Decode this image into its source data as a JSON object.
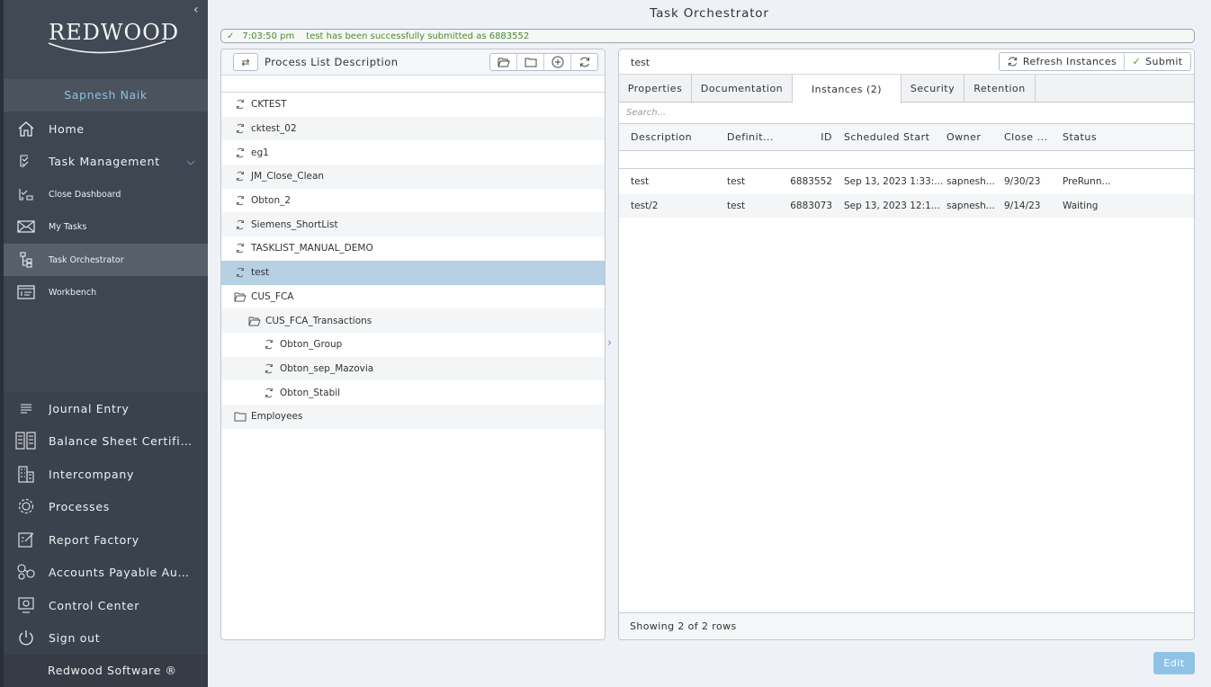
{
  "sidebar": {
    "logo_text": "Redwood",
    "user_name": "Sapnesh Naik",
    "items": [
      {
        "label": "Home",
        "icon": "home-icon"
      },
      {
        "label": "Task Management",
        "icon": "task-checklist-icon"
      },
      {
        "label": "Close Dashboard",
        "icon": "close-dashboard-icon"
      },
      {
        "label": "My Tasks",
        "icon": "envelope-icon"
      },
      {
        "label": "Task Orchestrator",
        "icon": "orchestrator-tree-icon"
      },
      {
        "label": "Workbench",
        "icon": "workbench-icon"
      }
    ],
    "lower_items": [
      {
        "label": "Journal Entry",
        "icon": "journal-lines-icon"
      },
      {
        "label": "Balance Sheet Certificati",
        "icon": "balance-sheet-icon"
      },
      {
        "label": "Intercompany",
        "icon": "buildings-icon"
      },
      {
        "label": "Processes",
        "icon": "gear-icon"
      },
      {
        "label": "Report Factory",
        "icon": "report-edit-icon"
      },
      {
        "label": "Accounts Payable Autom...",
        "icon": "nodes-icon"
      },
      {
        "label": "Control Center",
        "icon": "control-center-icon"
      },
      {
        "label": "Sign out",
        "icon": "power-icon"
      }
    ],
    "footer": "Redwood Software ®"
  },
  "page_title": "Task Orchestrator",
  "notification": {
    "time": "7:03:50 pm",
    "message": "test has been successfully submitted as 6883552"
  },
  "left_panel": {
    "title": "Process List Description",
    "tree": [
      {
        "label": "CKTEST",
        "type": "process",
        "level": 0
      },
      {
        "label": "cktest_02",
        "type": "process",
        "level": 0
      },
      {
        "label": "eg1",
        "type": "process",
        "level": 0
      },
      {
        "label": "JM_Close_Clean",
        "type": "process",
        "level": 0
      },
      {
        "label": "Obton_2",
        "type": "process",
        "level": 0
      },
      {
        "label": "Siemens_ShortList",
        "type": "process",
        "level": 0
      },
      {
        "label": "TASKLIST_MANUAL_DEMO",
        "type": "process",
        "level": 0
      },
      {
        "label": "test",
        "type": "process",
        "level": 0,
        "selected": true
      },
      {
        "label": "CUS_FCA",
        "type": "folder-open",
        "level": 0
      },
      {
        "label": "CUS_FCA_Transactions",
        "type": "folder-open",
        "level": 1
      },
      {
        "label": "Obton_Group",
        "type": "process",
        "level": 2
      },
      {
        "label": "Obton_sep_Mazovia",
        "type": "process",
        "level": 2
      },
      {
        "label": "Obton_Stabil",
        "type": "process",
        "level": 2
      },
      {
        "label": "Employees",
        "type": "folder",
        "level": 0
      }
    ]
  },
  "right_panel": {
    "title": "test",
    "refresh_label": "Refresh Instances",
    "submit_label": "Submit",
    "tabs": [
      {
        "label": "Properties",
        "active": false
      },
      {
        "label": "Documentation",
        "active": false
      },
      {
        "label": "Instances (2)",
        "active": true
      },
      {
        "label": "Security",
        "active": false
      },
      {
        "label": "Retention",
        "active": false
      }
    ],
    "search_placeholder": "Search...",
    "columns": [
      "Description",
      "Definit...",
      "ID",
      "Scheduled Start",
      "Owner",
      "Close ...",
      "Status"
    ],
    "rows": [
      [
        "test",
        "test",
        "6883552",
        "Sep 13, 2023 1:33:...",
        "sapnesh...",
        "9/30/23",
        "PreRunn..."
      ],
      [
        "test/2",
        "test",
        "6883073",
        "Sep 13, 2023 12:1...",
        "sapnesh...",
        "9/14/23",
        "Waiting"
      ]
    ],
    "footer": "Showing 2 of 2 rows"
  },
  "edit_label": "Edit",
  "colors": {
    "sidebar_bg": "#3d4651",
    "accent_blue": "#8ebfe0",
    "selected_row": "#b6d0e4",
    "success_green": "#4a8a2e",
    "edit_button": "#8fc3e6"
  }
}
